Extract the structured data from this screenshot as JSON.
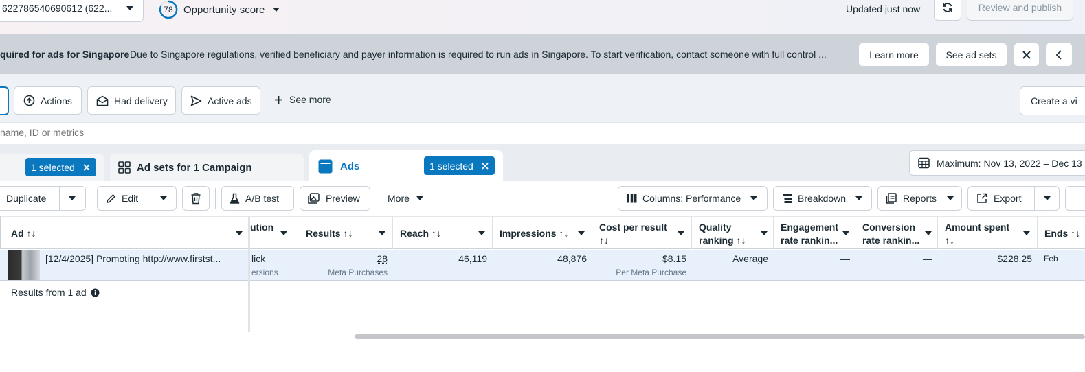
{
  "topbar": {
    "account_text": "622786540690612 (622...",
    "score": "78",
    "score_label": "Opportunity score",
    "updated": "Updated just now",
    "review_publish": "Review and publish"
  },
  "banner": {
    "title": "quired for ads for Singapore",
    "message": "Due to Singapore regulations, verified beneficiary and payer information is required to run ads in Singapore. To start verification, contact someone with full control ...",
    "learn_more": "Learn more",
    "see_ad_sets": "See ad sets"
  },
  "filters": {
    "actions": "Actions",
    "had_delivery": "Had delivery",
    "active_ads": "Active ads",
    "see_more": "See more",
    "create_view": "Create a vi"
  },
  "search": {
    "placeholder": "name, ID or metrics"
  },
  "levels": {
    "campaign_selected": "1 selected",
    "adsets_label": "Ad sets for 1 Campaign",
    "ads_label": "Ads",
    "ads_selected": "1 selected",
    "date_range": "Maximum: Nov 13, 2022 – Dec 13"
  },
  "toolbar": {
    "duplicate": "Duplicate",
    "edit": "Edit",
    "ab_test": "A/B test",
    "preview": "Preview",
    "more": "More",
    "columns": "Columns: Performance",
    "breakdown": "Breakdown",
    "reports": "Reports",
    "export": "Export"
  },
  "table": {
    "headers": {
      "ad": "Ad ↑↓",
      "attribution": "ution",
      "results": "Results ↑↓",
      "reach": "Reach ↑↓",
      "impressions": "Impressions ↑↓",
      "cost_per_result_1": "Cost per result",
      "cost_per_result_2": "↑↓",
      "quality_1": "Quality",
      "quality_2": "ranking ↑↓",
      "engagement_1": "Engagement",
      "engagement_2": "rate rankin...",
      "conversion_1": "Conversion",
      "conversion_2": "rate rankin...",
      "amount_1": "Amount spent",
      "amount_2": "↑↓",
      "ends": "Ends ↑↓"
    },
    "row": {
      "ad_name": "[12/4/2025] Promoting http://www.firstst...",
      "attribution": "lick",
      "attribution_sub": "ersions",
      "results": "28",
      "results_sub": "Meta Purchases",
      "reach": "46,119",
      "impressions": "48,876",
      "cost_per_result": "$8.15",
      "cost_sub": "Per Meta Purchase",
      "quality": "Average",
      "engagement": "—",
      "conversion": "—",
      "amount_spent": "$228.25",
      "ends": "Feb"
    },
    "footer": "Results from 1 ad"
  }
}
